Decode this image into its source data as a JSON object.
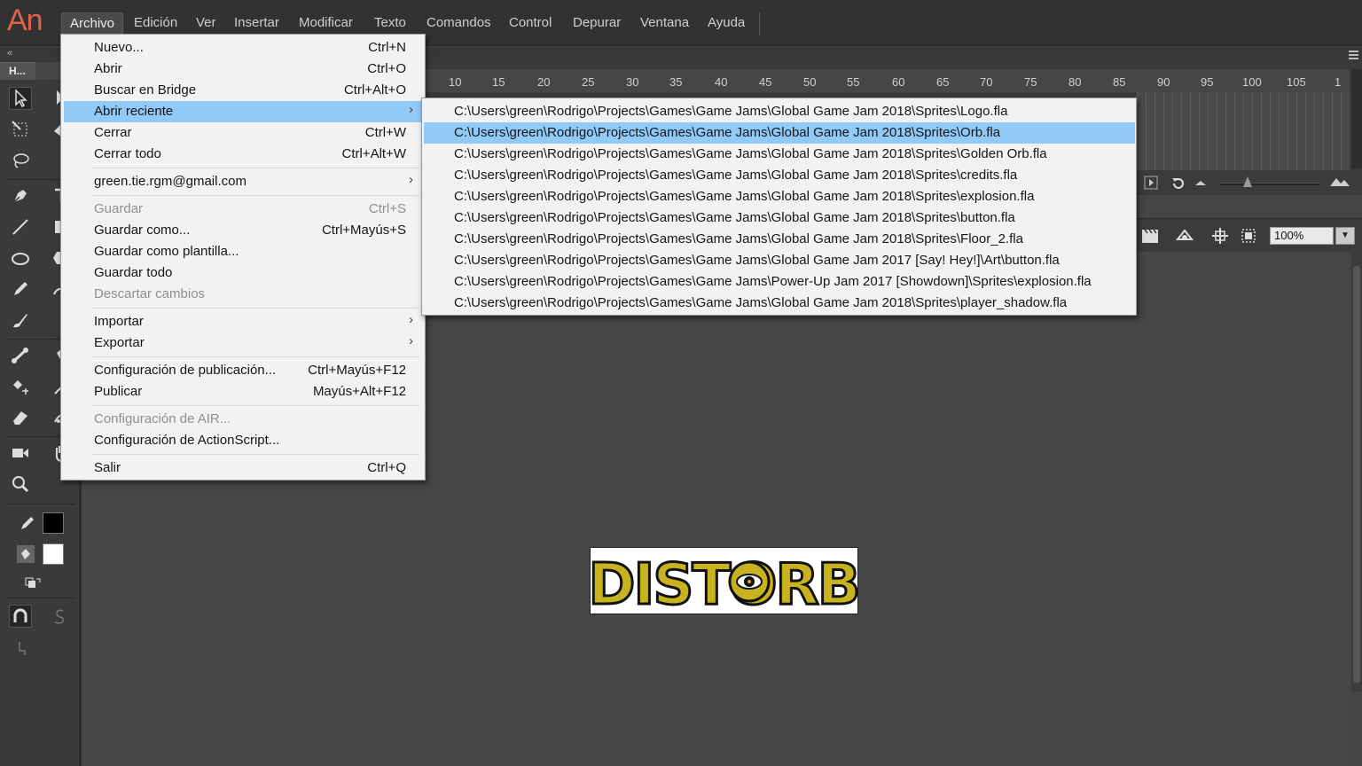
{
  "app": {
    "logo": "An"
  },
  "menubar": {
    "items": [
      {
        "label": "Archivo",
        "active": true
      },
      {
        "label": "Edición"
      },
      {
        "label": "Ver"
      },
      {
        "label": "Insertar"
      },
      {
        "label": "Modificar"
      },
      {
        "label": "Texto"
      },
      {
        "label": "Comandos"
      },
      {
        "label": "Control"
      },
      {
        "label": "Depurar"
      },
      {
        "label": "Ventana"
      },
      {
        "label": "Ayuda"
      }
    ]
  },
  "panel": {
    "tab_label": "H...",
    "collapse_glyph": "«"
  },
  "file_menu": {
    "items": [
      {
        "label": "Nuevo...",
        "shortcut": "Ctrl+N"
      },
      {
        "label": "Abrir",
        "shortcut": "Ctrl+O"
      },
      {
        "label": "Buscar en Bridge",
        "shortcut": "Ctrl+Alt+O"
      },
      {
        "label": "Abrir reciente",
        "shortcut": "",
        "submenu": true,
        "highlighted": true
      },
      {
        "label": "Cerrar",
        "shortcut": "Ctrl+W"
      },
      {
        "label": "Cerrar todo",
        "shortcut": "Ctrl+Alt+W"
      },
      {
        "label": "green.tie.rgm@gmail.com",
        "shortcut": "",
        "submenu": true
      },
      {
        "label": "Guardar",
        "shortcut": "Ctrl+S",
        "disabled": true
      },
      {
        "label": "Guardar como...",
        "shortcut": "Ctrl+Mayús+S"
      },
      {
        "label": "Guardar como plantilla...",
        "shortcut": ""
      },
      {
        "label": "Guardar todo",
        "shortcut": ""
      },
      {
        "label": "Descartar cambios",
        "shortcut": "",
        "disabled": true
      },
      {
        "label": "Importar",
        "shortcut": "",
        "submenu": true
      },
      {
        "label": "Exportar",
        "shortcut": "",
        "submenu": true
      },
      {
        "label": "Configuración de publicación...",
        "shortcut": "Ctrl+Mayús+F12"
      },
      {
        "label": "Publicar",
        "shortcut": "Mayús+Alt+F12"
      },
      {
        "label": "Configuración de AIR...",
        "shortcut": "",
        "disabled": true
      },
      {
        "label": "Configuración de ActionScript...",
        "shortcut": ""
      },
      {
        "label": "Salir",
        "shortcut": "Ctrl+Q"
      }
    ],
    "submenu_arrow": "›"
  },
  "recent_menu": {
    "items": [
      "C:\\Users\\green\\Rodrigo\\Projects\\Games\\Game Jams\\Global Game Jam 2018\\Sprites\\Logo.fla",
      "C:\\Users\\green\\Rodrigo\\Projects\\Games\\Game Jams\\Global Game Jam 2018\\Sprites\\Orb.fla",
      "C:\\Users\\green\\Rodrigo\\Projects\\Games\\Game Jams\\Global Game Jam 2018\\Sprites\\Golden Orb.fla",
      "C:\\Users\\green\\Rodrigo\\Projects\\Games\\Game Jams\\Global Game Jam 2018\\Sprites\\credits.fla",
      "C:\\Users\\green\\Rodrigo\\Projects\\Games\\Game Jams\\Global Game Jam 2018\\Sprites\\explosion.fla",
      "C:\\Users\\green\\Rodrigo\\Projects\\Games\\Game Jams\\Global Game Jam 2018\\Sprites\\button.fla",
      "C:\\Users\\green\\Rodrigo\\Projects\\Games\\Game Jams\\Global Game Jam 2018\\Sprites\\Floor_2.fla",
      "C:\\Users\\green\\Rodrigo\\Projects\\Games\\Game Jams\\Global Game Jam 2017 [Say! Hey!]\\Art\\button.fla",
      "C:\\Users\\green\\Rodrigo\\Projects\\Games\\Game Jams\\Power-Up Jam 2017 [Showdown]\\Sprites\\explosion.fla",
      "C:\\Users\\green\\Rodrigo\\Projects\\Games\\Game Jams\\Global Game Jam 2018\\Sprites\\player_shadow.fla"
    ],
    "highlighted_index": 1
  },
  "timeline": {
    "ruler_ticks": [
      "10",
      "15",
      "20",
      "25",
      "30",
      "35",
      "40",
      "45",
      "50",
      "55",
      "60",
      "65",
      "70",
      "75",
      "80",
      "85",
      "90",
      "95",
      "100",
      "105",
      "1"
    ]
  },
  "editbar": {
    "zoom": "100%",
    "zoom_dropdown_glyph": "▼"
  },
  "stage": {
    "logo_text": "DISTORB"
  },
  "colors": {
    "menu_highlight": "#91c9f7",
    "logo_fill": "#c9b21f",
    "app_logo": "#e0624c",
    "stroke_color": "#000000",
    "fill_color": "#ffffff"
  }
}
